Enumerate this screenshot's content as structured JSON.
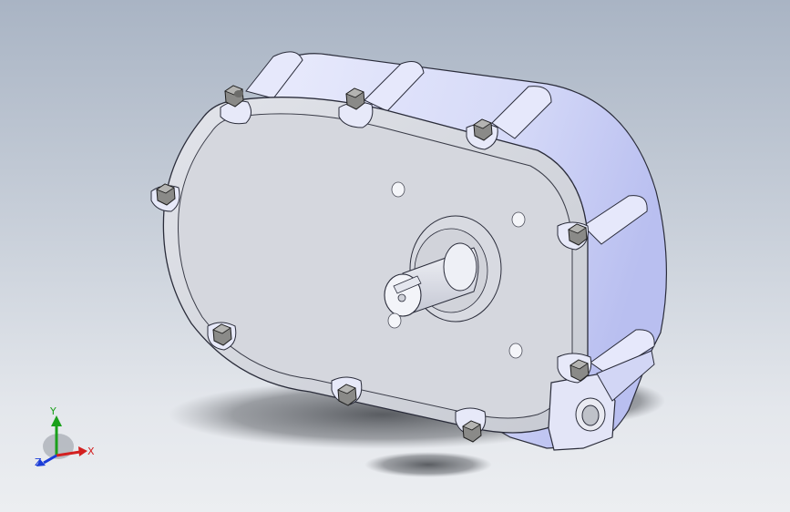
{
  "viewport": {
    "background_top": "#a9b4c4",
    "background_bottom": "#eceef1"
  },
  "model": {
    "body_color": "#dcdff9",
    "face_color": "#d0d3da",
    "bolt_color": "#8a8a88"
  },
  "triad": {
    "x_label": "X",
    "y_label": "Y",
    "z_label": "Z",
    "x_color": "#d32020",
    "y_color": "#1aa01a",
    "z_color": "#1a3cd8"
  }
}
